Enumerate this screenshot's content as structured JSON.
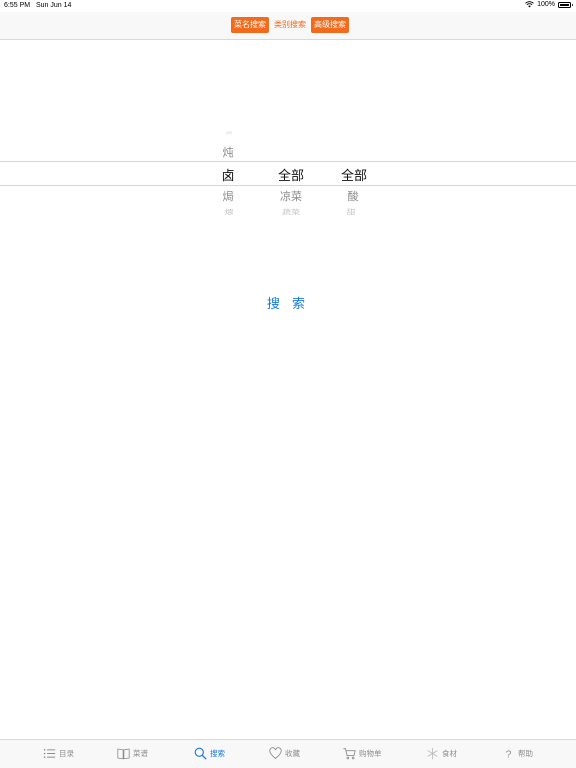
{
  "status_bar": {
    "time": "6:55 PM",
    "date": "Sun Jun 14",
    "battery": "100%"
  },
  "nav": {
    "segments": [
      {
        "label": "菜名搜索",
        "selected": true
      },
      {
        "label": "类别搜索",
        "selected": false
      },
      {
        "label": "高级搜索",
        "selected": true
      }
    ]
  },
  "picker": {
    "col1": {
      "above2": "烤",
      "above1": "炖",
      "selected": "卤",
      "below1": "焗",
      "below2": "煨"
    },
    "col2": {
      "selected": "全部",
      "below1": "凉菜",
      "below2": "蔬菜"
    },
    "col3": {
      "selected": "全部",
      "below1": "酸",
      "below2": "甜"
    }
  },
  "search_button": "搜 索",
  "tabs": [
    {
      "label": "目录",
      "icon": "list-icon",
      "active": false
    },
    {
      "label": "菜谱",
      "icon": "book-icon",
      "active": false
    },
    {
      "label": "搜索",
      "icon": "search-icon",
      "active": true
    },
    {
      "label": "收藏",
      "icon": "heart-icon",
      "active": false
    },
    {
      "label": "购物单",
      "icon": "cart-icon",
      "active": false
    },
    {
      "label": "食材",
      "icon": "snowflake-icon",
      "active": false
    },
    {
      "label": "帮助",
      "icon": "question-icon",
      "active": false
    }
  ],
  "colors": {
    "accent_orange": "#f26a1b",
    "accent_blue": "#1a78e0",
    "inactive": "#8e8e8e"
  }
}
